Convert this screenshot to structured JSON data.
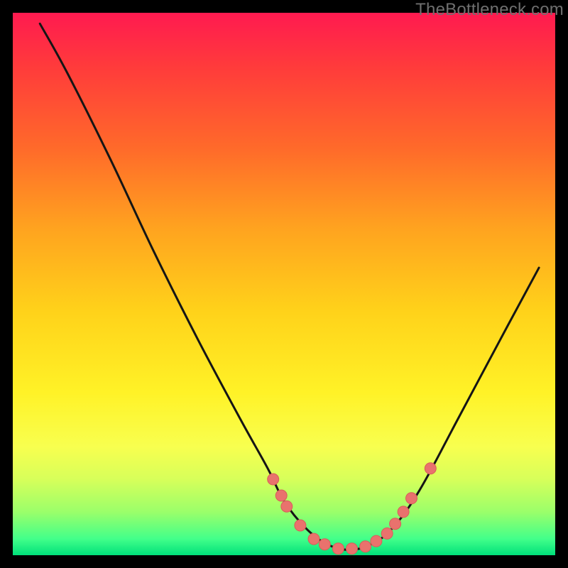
{
  "watermark": {
    "text": "TheBottleneck.com"
  },
  "colors": {
    "curve_stroke": "#151515",
    "dot_fill": "#e9726d",
    "dot_stroke": "#d85e59"
  },
  "chart_data": {
    "type": "line",
    "title": "",
    "xlabel": "",
    "ylabel": "",
    "xlim": [
      0,
      100
    ],
    "ylim": [
      0,
      100
    ],
    "curve_points": [
      {
        "x": 5.0,
        "y": 98.0
      },
      {
        "x": 10.0,
        "y": 89.0
      },
      {
        "x": 18.0,
        "y": 73.0
      },
      {
        "x": 26.0,
        "y": 56.0
      },
      {
        "x": 34.0,
        "y": 40.0
      },
      {
        "x": 42.0,
        "y": 25.0
      },
      {
        "x": 47.0,
        "y": 16.0
      },
      {
        "x": 50.0,
        "y": 10.0
      },
      {
        "x": 54.0,
        "y": 5.0
      },
      {
        "x": 58.0,
        "y": 2.0
      },
      {
        "x": 62.0,
        "y": 1.0
      },
      {
        "x": 66.0,
        "y": 2.0
      },
      {
        "x": 70.0,
        "y": 5.0
      },
      {
        "x": 75.0,
        "y": 12.0
      },
      {
        "x": 82.0,
        "y": 25.0
      },
      {
        "x": 90.0,
        "y": 40.0
      },
      {
        "x": 97.0,
        "y": 53.0
      }
    ],
    "dots": [
      {
        "x": 48.0,
        "y": 14.0
      },
      {
        "x": 49.5,
        "y": 11.0
      },
      {
        "x": 50.5,
        "y": 9.0
      },
      {
        "x": 53.0,
        "y": 5.5
      },
      {
        "x": 55.5,
        "y": 3.0
      },
      {
        "x": 57.5,
        "y": 2.0
      },
      {
        "x": 60.0,
        "y": 1.2
      },
      {
        "x": 62.5,
        "y": 1.2
      },
      {
        "x": 65.0,
        "y": 1.6
      },
      {
        "x": 67.0,
        "y": 2.6
      },
      {
        "x": 69.0,
        "y": 4.0
      },
      {
        "x": 70.5,
        "y": 5.8
      },
      {
        "x": 72.0,
        "y": 8.0
      },
      {
        "x": 73.5,
        "y": 10.5
      },
      {
        "x": 77.0,
        "y": 16.0
      }
    ]
  }
}
